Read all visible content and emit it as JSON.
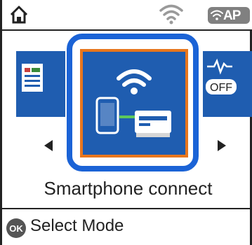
{
  "header": {
    "home_icon": "home-icon",
    "wifi_icon": "wifi-icon",
    "ap_badge": "AP"
  },
  "carousel": {
    "selected_item": "Smartphone connect",
    "left_tile_icon": "document-icon",
    "right_tile_icon": "power-off-icon",
    "right_tile_badge": "OFF",
    "left_arrow": "prev-arrow-icon",
    "right_arrow": "next-arrow-icon"
  },
  "footer": {
    "ok_icon": "ok-button-icon",
    "ok_label": "OK",
    "hint": "Select Mode"
  },
  "colors": {
    "tile_blue": "#1f5db0",
    "focus_blue": "#1b63d6",
    "highlight_orange": "#e8761d",
    "badge_gray": "#808080"
  }
}
